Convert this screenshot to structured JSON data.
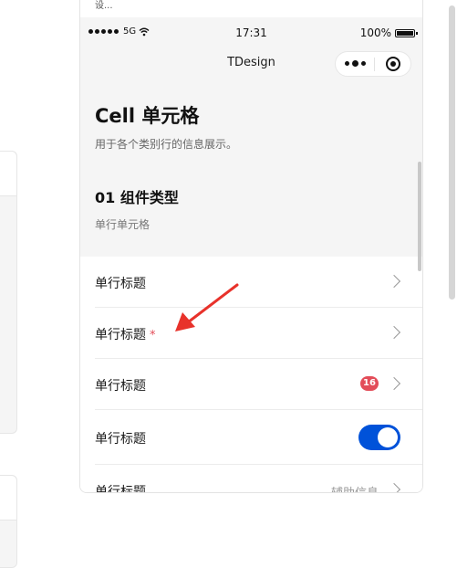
{
  "phone": {
    "top_fragment": "设...",
    "statusbar": {
      "carrier": "5G",
      "time": "17:31",
      "battery": "100%"
    },
    "navbar": {
      "title": "TDesign"
    }
  },
  "page": {
    "title": "Cell 单元格",
    "description": "用于各个类别行的信息展示。",
    "section_title": "01 组件类型",
    "section_subtitle": "单行单元格"
  },
  "cells": [
    {
      "label": "单行标题"
    },
    {
      "label": "单行标题",
      "required_mark": "*"
    },
    {
      "label": "单行标题",
      "badge": "16"
    },
    {
      "label": "单行标题",
      "toggle_on": true
    },
    {
      "label": "单行标题",
      "note": "辅助信息"
    }
  ],
  "colors": {
    "accent": "#0052d9",
    "badge": "#e34d59",
    "arrow": "#e8322b"
  }
}
